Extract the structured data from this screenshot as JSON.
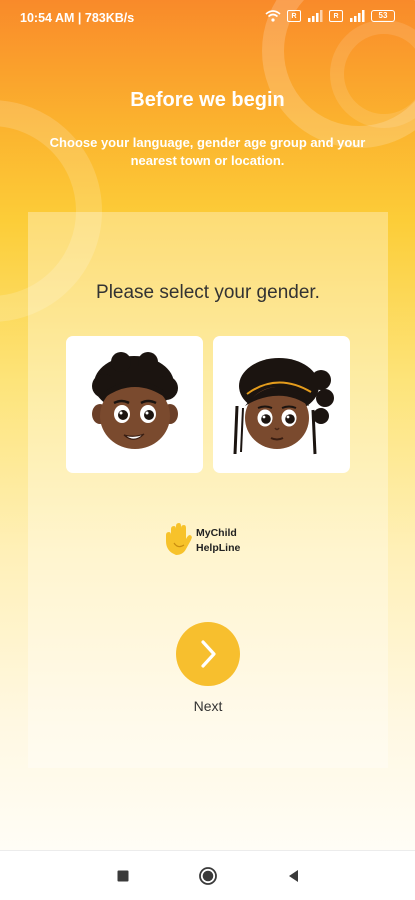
{
  "status_bar": {
    "time": "10:54 AM | 783KB/s",
    "alarm_icon": "alarm-clock-icon",
    "wifi_icon": "wifi-icon",
    "sim1_label": "R",
    "sim2_label": "R",
    "battery_level": "53"
  },
  "header": {
    "title": "Before we begin",
    "subtitle": "Choose your language, gender age group and your nearest town or location."
  },
  "gender_select": {
    "prompt": "Please select your gender.",
    "options": [
      {
        "icon": "boy-avatar-icon"
      },
      {
        "icon": "girl-avatar-icon"
      }
    ]
  },
  "logo": {
    "line1": "MyChild",
    "line2": "HelpLine",
    "color": "#f7c22a"
  },
  "next": {
    "label": "Next",
    "icon": "chevron-right-icon",
    "color": "#f7bf2e"
  },
  "nav_bar": {
    "recent_icon": "square-icon",
    "home_icon": "circle-icon",
    "back_icon": "triangle-back-icon"
  }
}
